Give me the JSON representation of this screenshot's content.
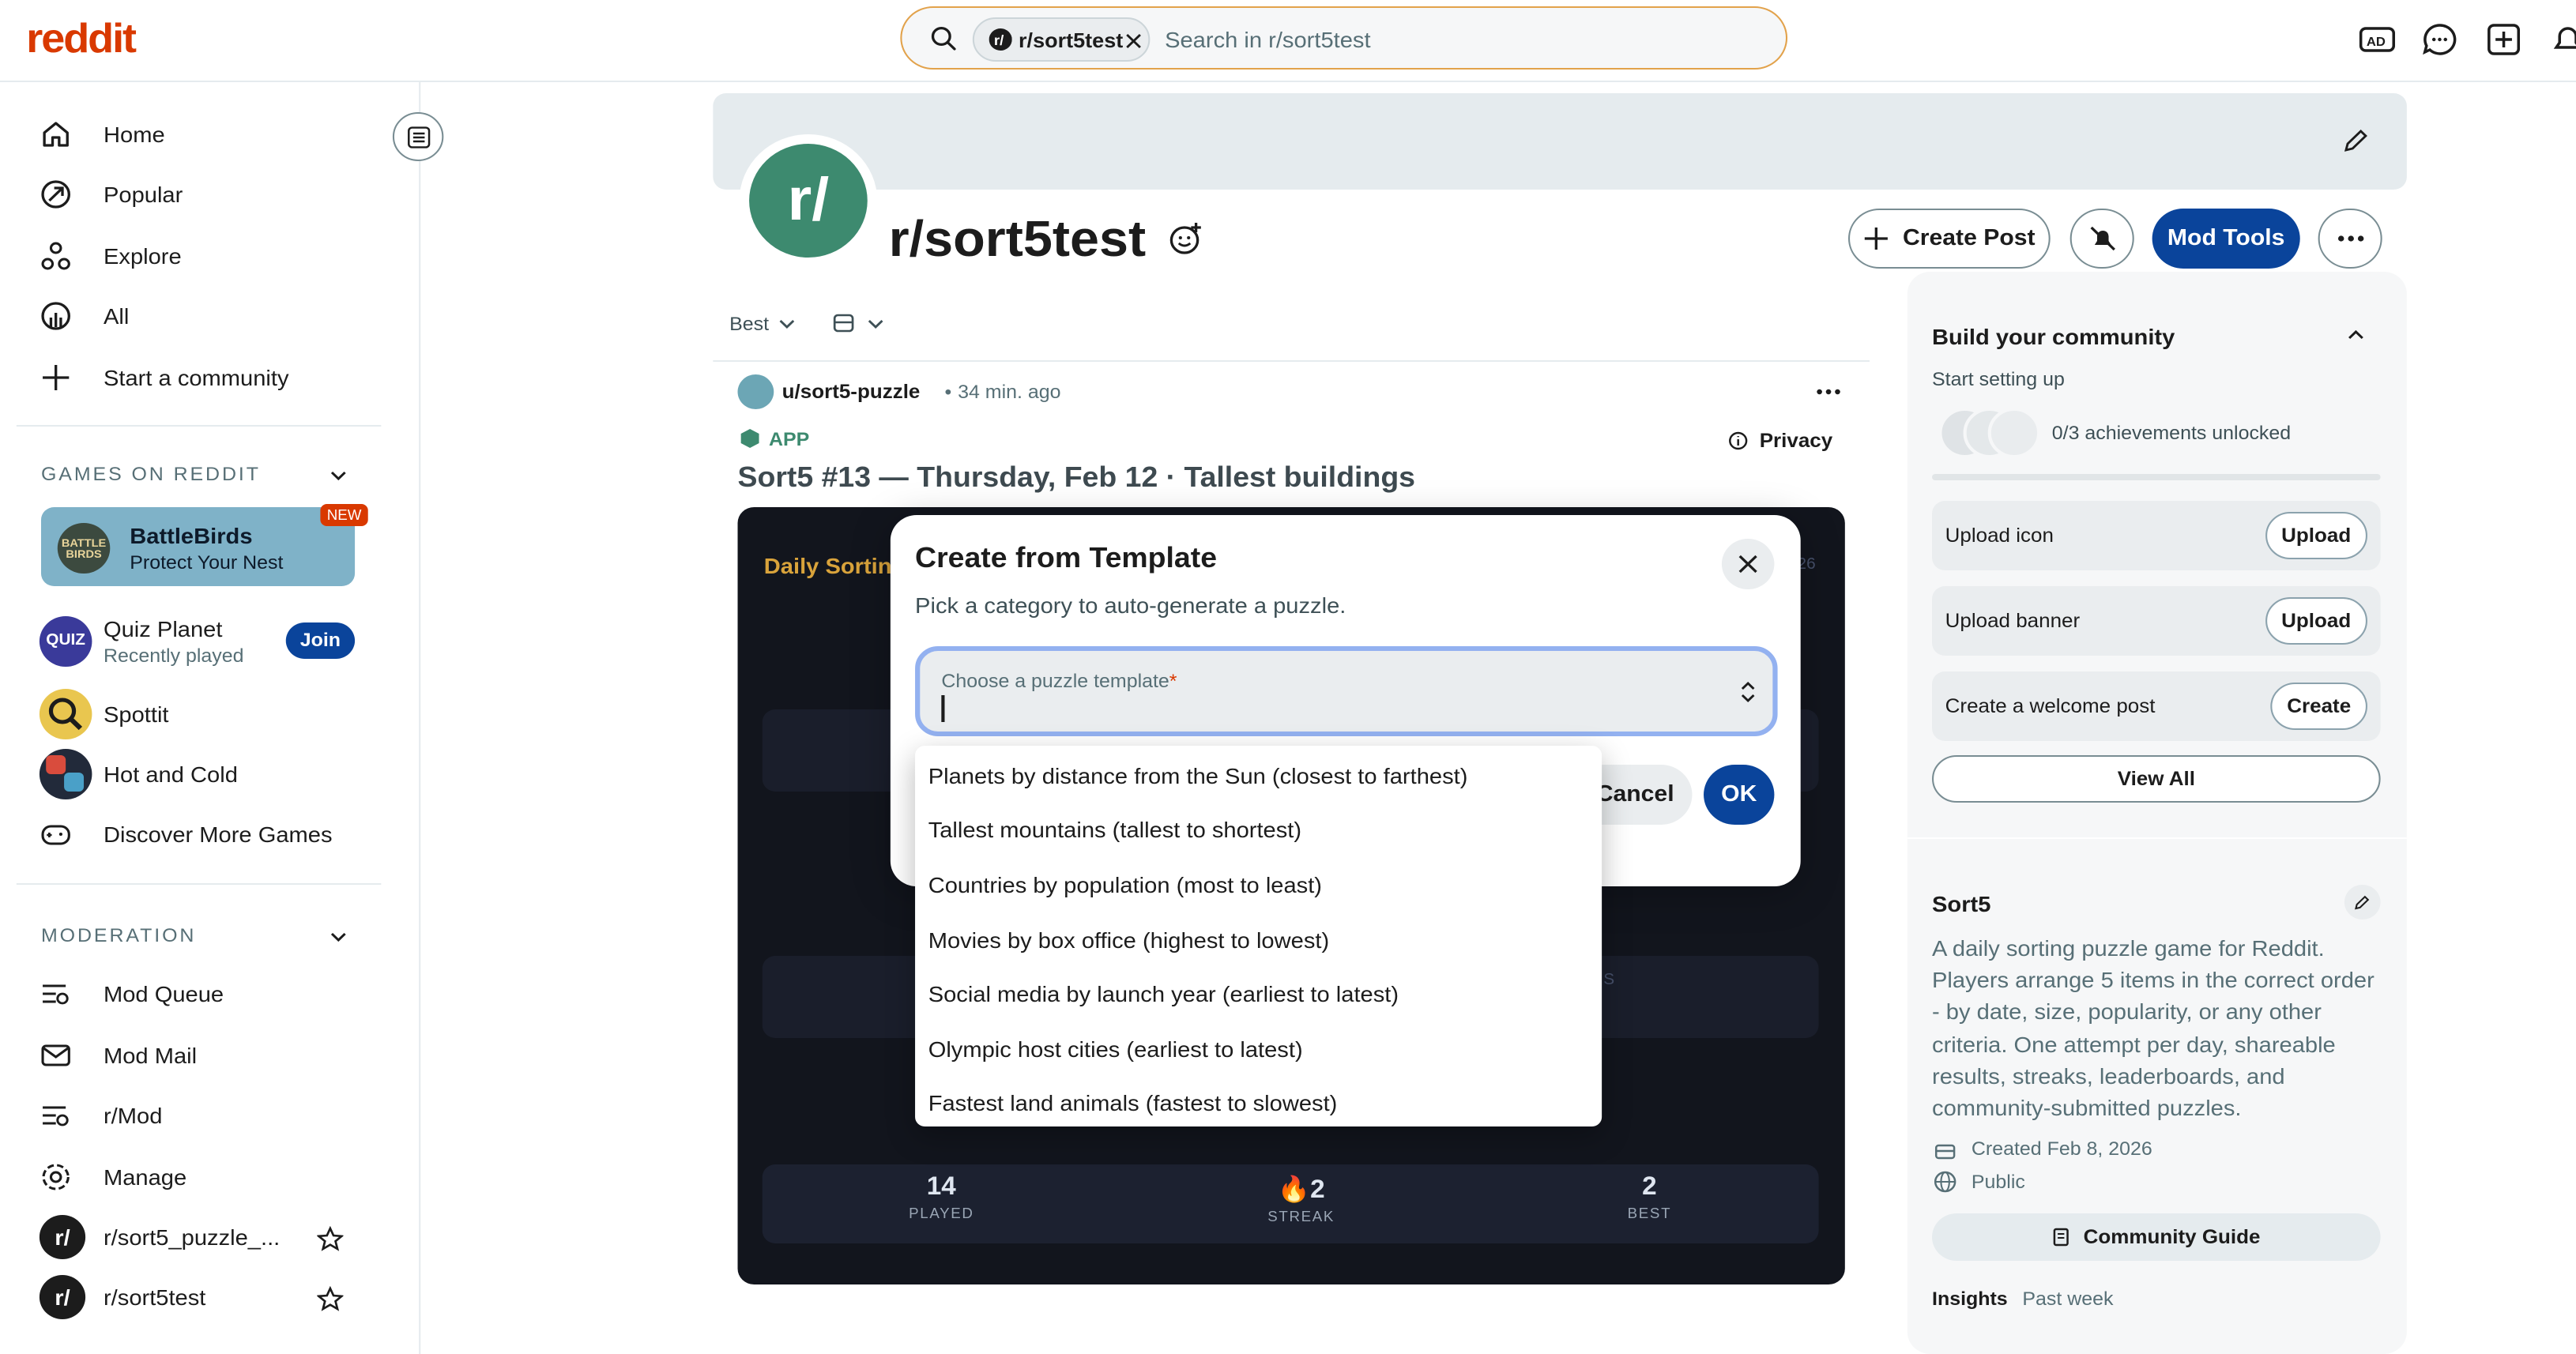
{
  "header": {
    "logo": "reddit",
    "search_chip": "r/sort5test",
    "search_placeholder": "Search in r/sort5test"
  },
  "sidebar": {
    "nav": [
      {
        "label": "Home",
        "icon": "home-icon"
      },
      {
        "label": "Popular",
        "icon": "popular-icon"
      },
      {
        "label": "Explore",
        "icon": "explore-icon"
      },
      {
        "label": "All",
        "icon": "all-icon"
      },
      {
        "label": "Start a community",
        "icon": "plus-icon"
      }
    ],
    "games_title": "GAMES ON REDDIT",
    "games": {
      "featured_name": "BattleBirds",
      "featured_sub": "Protect Your Nest",
      "featured_badge": "NEW",
      "quiz_name": "Quiz Planet",
      "quiz_sub": "Recently played",
      "quiz_join": "Join",
      "spottit": "Spottit",
      "hotcold": "Hot and Cold",
      "discover": "Discover More Games"
    },
    "moderation_title": "MODERATION",
    "moderation": [
      {
        "label": "Mod Queue"
      },
      {
        "label": "Mod Mail"
      },
      {
        "label": "r/Mod"
      },
      {
        "label": "Manage"
      },
      {
        "label": "r/sort5_puzzle_..."
      },
      {
        "label": "r/sort5test"
      }
    ]
  },
  "community": {
    "name": "r/sort5test",
    "avatar_text": "r/",
    "create_post": "Create Post",
    "mod_tools": "Mod Tools",
    "sort": "Best"
  },
  "post": {
    "author": "u/sort5-puzzle",
    "time": "34 min. ago",
    "app_tag": "APP",
    "privacy": "Privacy",
    "title": "Sort5 #13 — Thursday, Feb 12 · Tallest buildings",
    "card_heading": "Daily Sortin",
    "card_right": "26",
    "card_faint": "S",
    "stats": [
      {
        "value": "14",
        "label": "PLAYED"
      },
      {
        "value": "2",
        "label": "STREAK"
      },
      {
        "value": "2",
        "label": "BEST"
      }
    ]
  },
  "right": {
    "build_title": "Build your community",
    "build_sub": "Start setting up",
    "achievements": "0/3 achievements unlocked",
    "tasks": [
      {
        "label": "Upload icon",
        "button": "Upload"
      },
      {
        "label": "Upload banner",
        "button": "Upload"
      },
      {
        "label": "Create a welcome post",
        "button": "Create"
      }
    ],
    "view_all": "View All",
    "about_title": "Sort5",
    "about_desc": "A daily sorting puzzle game for Reddit. Players arrange 5 items in the correct order - by date, size, popularity, or any other criteria. One attempt per day, shareable results, streaks, leaderboards, and community-submitted puzzles.",
    "created": "Created Feb 8, 2026",
    "visibility": "Public",
    "guide": "Community Guide",
    "insights": "Insights",
    "insights_period": "Past week"
  },
  "modal": {
    "title": "Create from Template",
    "subtitle": "Pick a category to auto-generate a puzzle.",
    "select_label": "Choose a puzzle template",
    "required_mark": "*",
    "options": [
      "Planets by distance from the Sun (closest to farthest)",
      "Tallest mountains (tallest to shortest)",
      "Countries by population (most to least)",
      "Movies by box office (highest to lowest)",
      "Social media by launch year (earliest to latest)",
      "Olympic host cities (earliest to latest)",
      "Fastest land animals (fastest to slowest)"
    ],
    "cancel": "Cancel",
    "ok": "OK"
  },
  "colors": {
    "brand": "#d93900",
    "primary_button": "#0a449b",
    "card_dark": "#12151d",
    "select_focus": "#93b1f0"
  }
}
